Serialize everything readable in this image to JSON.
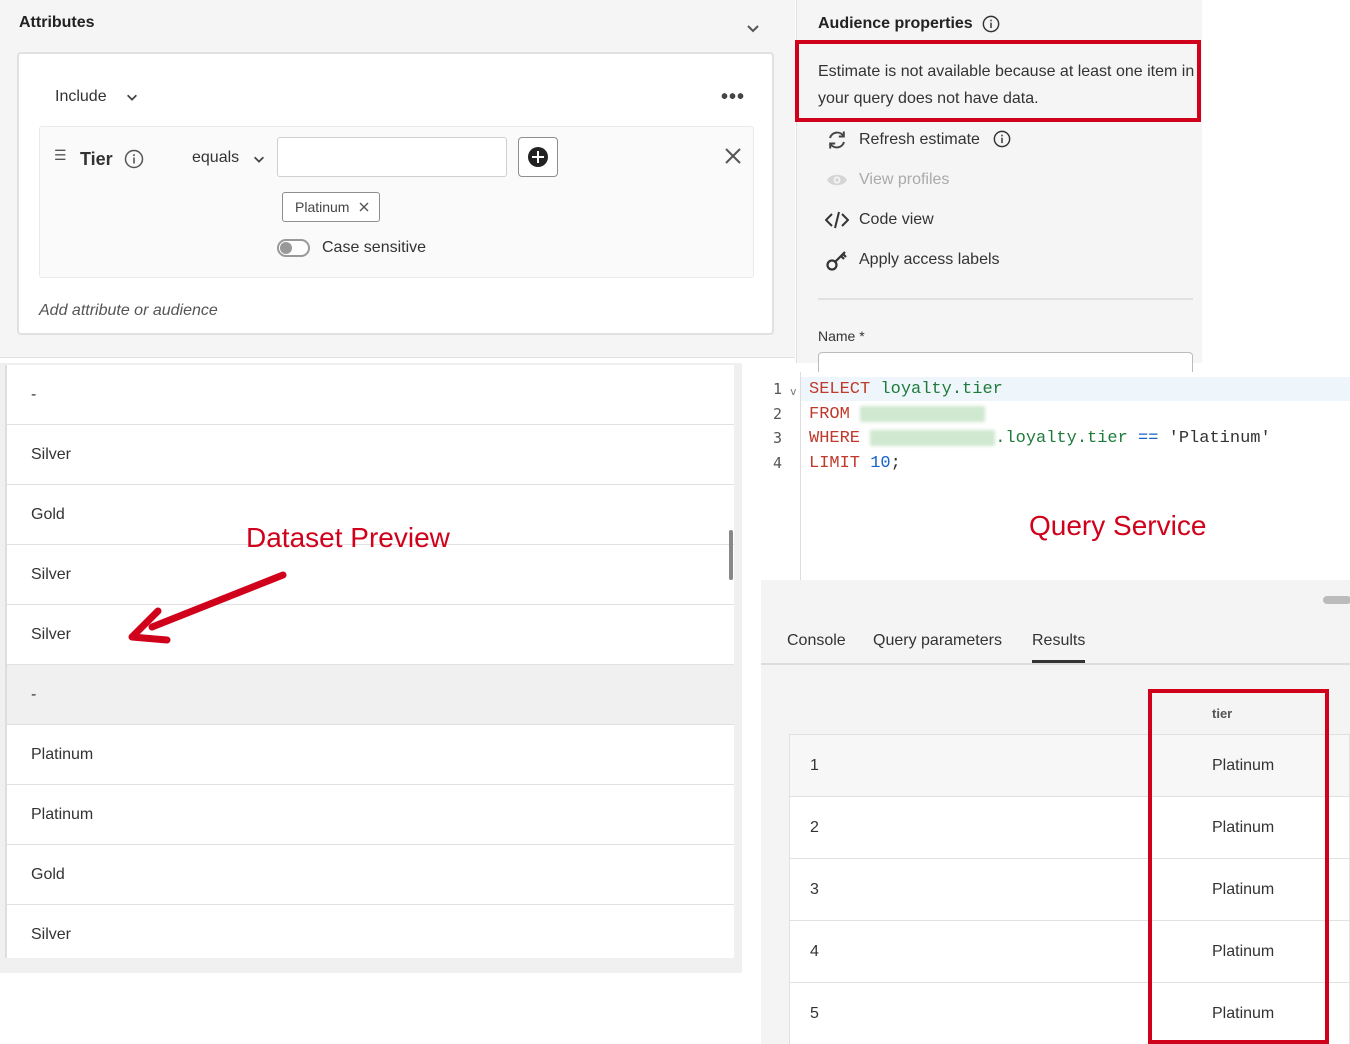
{
  "attributes": {
    "title": "Attributes",
    "include_label": "Include",
    "more_menu": "•••",
    "rule": {
      "attribute": "Tier",
      "operator": "equals",
      "input_value": "",
      "tag": "Platinum",
      "case_sensitive_label": "Case sensitive",
      "case_sensitive_on": false
    },
    "add_attribute": "Add attribute or audience"
  },
  "audience": {
    "title": "Audience properties",
    "estimate_message": "Estimate is not available because at least one item in your query does not have data.",
    "actions": {
      "refresh": "Refresh estimate",
      "view_profiles": "View profiles",
      "code_view": "Code view",
      "apply_labels": "Apply access labels"
    },
    "name_label": "Name",
    "required_marker": "*"
  },
  "dataset_preview": {
    "caption": "Dataset Preview",
    "rows": [
      "-",
      "Silver",
      "Gold",
      "Silver",
      "Silver",
      "-",
      "Platinum",
      "Platinum",
      "Gold",
      "Silver"
    ]
  },
  "query_service": {
    "caption": "Query Service",
    "line_numbers": [
      "1",
      "2",
      "3",
      "4"
    ],
    "fold_marker": "v",
    "code": {
      "l1_kw": "SELECT",
      "l1_rest": "loyalty.tier",
      "l2_kw": "FROM",
      "l3_kw": "WHERE",
      "l3_rest": ".loyalty.tier",
      "l3_op": "==",
      "l3_str": "'Platinum'",
      "l4_kw": "LIMIT",
      "l4_num": "10",
      "l4_end": ";"
    },
    "tabs": {
      "console": "Console",
      "params": "Query parameters",
      "results": "Results",
      "active": "Results"
    },
    "column_header": "tier",
    "results": [
      {
        "idx": "1",
        "tier": "Platinum"
      },
      {
        "idx": "2",
        "tier": "Platinum"
      },
      {
        "idx": "3",
        "tier": "Platinum"
      },
      {
        "idx": "4",
        "tier": "Platinum"
      },
      {
        "idx": "5",
        "tier": "Platinum"
      }
    ]
  },
  "colors": {
    "annotation_red": "#d0021b",
    "sql_keyword": "#c0392b",
    "sql_identifier": "#1e7b3a",
    "sql_number": "#1763c8"
  }
}
